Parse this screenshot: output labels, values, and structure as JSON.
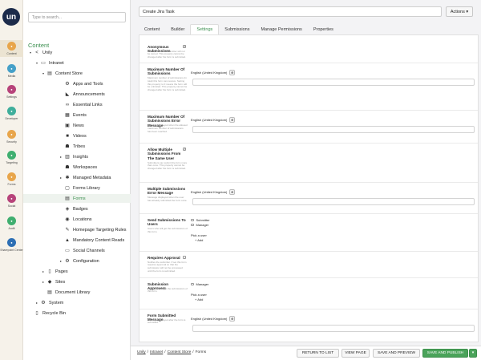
{
  "app": {
    "logo_text": "un"
  },
  "rail": [
    {
      "label": "Content",
      "icon": "content-icon",
      "color": "#e8a54a",
      "active": true
    },
    {
      "label": "Media",
      "icon": "media-icon",
      "color": "#46a0c8"
    },
    {
      "label": "Settings",
      "icon": "settings-icon",
      "color": "#b7437a"
    },
    {
      "label": "Developer",
      "icon": "developer-icon",
      "color": "#3fae9b"
    },
    {
      "label": "Security",
      "icon": "security-icon",
      "color": "#e8a54a"
    },
    {
      "label": "Targeting",
      "icon": "targeting-icon",
      "color": "#3fae6f"
    },
    {
      "label": "Forms",
      "icon": "forms-icon",
      "color": "#e8a54a"
    },
    {
      "label": "Social",
      "icon": "social-icon",
      "color": "#b7437a"
    },
    {
      "label": "Audit",
      "icon": "audit-icon",
      "color": "#3fae6f"
    },
    {
      "label": "Sharepoint Center",
      "icon": "sharepoint-icon",
      "color": "#2d6fb4"
    }
  ],
  "tree": {
    "search_placeholder": "Type to search...",
    "header": "Content",
    "nodes": [
      {
        "label": "Unily",
        "level": 0,
        "arrow": "▾",
        "icon": "share-icon",
        "glyph": "<"
      },
      {
        "label": "Intranet",
        "level": 1,
        "arrow": "▾",
        "icon": "monitor-icon",
        "glyph": "▭"
      },
      {
        "label": "Content Store",
        "level": 2,
        "arrow": "▾",
        "icon": "content-store-icon",
        "glyph": "▤"
      },
      {
        "label": "Apps and Tools",
        "level": 3,
        "arrow": "",
        "icon": "apps-icon",
        "glyph": "⚙"
      },
      {
        "label": "Announcements",
        "level": 3,
        "arrow": "",
        "icon": "megaphone-icon",
        "glyph": "◣"
      },
      {
        "label": "Essential Links",
        "level": 3,
        "arrow": "",
        "icon": "link-icon",
        "glyph": "∞"
      },
      {
        "label": "Events",
        "level": 3,
        "arrow": "",
        "icon": "calendar-icon",
        "glyph": "▦"
      },
      {
        "label": "News",
        "level": 3,
        "arrow": "",
        "icon": "news-icon",
        "glyph": "▣"
      },
      {
        "label": "Videos",
        "level": 3,
        "arrow": "",
        "icon": "video-icon",
        "glyph": "■"
      },
      {
        "label": "Tribes",
        "level": 3,
        "arrow": "",
        "icon": "tribes-icon",
        "glyph": "☗"
      },
      {
        "label": "Insights",
        "level": 3,
        "arrow": "▸",
        "icon": "insights-icon",
        "glyph": "▥"
      },
      {
        "label": "Workspaces",
        "level": 3,
        "arrow": "",
        "icon": "workspaces-icon",
        "glyph": "☗"
      },
      {
        "label": "Managed Metadata",
        "level": 3,
        "arrow": "▸",
        "icon": "metadata-icon",
        "glyph": "✱"
      },
      {
        "label": "Forms Library",
        "level": 3,
        "arrow": "",
        "icon": "forms-library-icon",
        "glyph": "▢"
      },
      {
        "label": "Forms",
        "level": 3,
        "arrow": "",
        "icon": "forms-icon",
        "glyph": "▤",
        "active": true
      },
      {
        "label": "Badges",
        "level": 3,
        "arrow": "",
        "icon": "badge-icon",
        "glyph": "◈"
      },
      {
        "label": "Locations",
        "level": 3,
        "arrow": "",
        "icon": "location-icon",
        "glyph": "◉"
      },
      {
        "label": "Homepage Targeting Rules",
        "level": 3,
        "arrow": "",
        "icon": "targeting-rules-icon",
        "glyph": "✎"
      },
      {
        "label": "Mandatory Content Reads",
        "level": 3,
        "arrow": "",
        "icon": "warning-icon",
        "glyph": "▲"
      },
      {
        "label": "Social Channels",
        "level": 3,
        "arrow": "",
        "icon": "social-channels-icon",
        "glyph": "▭"
      },
      {
        "label": "Configuration",
        "level": 3,
        "arrow": "▸",
        "icon": "configuration-icon",
        "glyph": "⚙"
      },
      {
        "label": "Pages",
        "level": 2,
        "arrow": "▸",
        "icon": "pages-icon",
        "glyph": "▯"
      },
      {
        "label": "Sites",
        "level": 2,
        "arrow": "▸",
        "icon": "sites-icon",
        "glyph": "◆"
      },
      {
        "label": "Document Library",
        "level": 2,
        "arrow": "",
        "icon": "document-library-icon",
        "glyph": "▤"
      },
      {
        "label": "System",
        "level": 1,
        "arrow": "▸",
        "icon": "system-icon",
        "glyph": "⚙"
      },
      {
        "label": "Recycle Bin",
        "level": 0,
        "arrow": "",
        "icon": "recycle-bin-icon",
        "glyph": "▯"
      }
    ]
  },
  "header": {
    "title_value": "Create Jira Task",
    "actions_label": "Actions ▾",
    "tabs": [
      {
        "label": "Content"
      },
      {
        "label": "Builder"
      },
      {
        "label": "Settings",
        "active": true
      },
      {
        "label": "Submissions"
      },
      {
        "label": "Manage Permissions"
      },
      {
        "label": "Properties"
      }
    ]
  },
  "settings": {
    "language": "English (United Kingdom)",
    "props": [
      {
        "label": "Anonymous Submissions",
        "desc": "If true, data of the submitter will not be stored. This property cannot be changed after the form is submitted."
      },
      {
        "label": "Maximum Number Of Submissions",
        "desc": "Maximum number of submissions (in total) this form can receive. Setting this property to 0 means the form will be unlimited. This property cannot be changed after the form is submitted."
      },
      {
        "label": "Maximum Number Of Submissions Error Message",
        "desc": "Message displayed when the allowed maximum number of submissions has been reached."
      },
      {
        "label": "Allow Multiple Submissions From The Same User",
        "desc": "Submitters can submit the form more than once. This property cannot be changed after the form is submitted."
      },
      {
        "label": "Multiple Submissions Error Message",
        "desc": "Message displayed when the user has already submitted the form once."
      },
      {
        "label": "Send Submissions To Users",
        "desc": "Users who will get the submissions of this form.",
        "options": [
          "Submitter",
          "Manager"
        ],
        "pick": "Pick a user",
        "add": "+ Add"
      },
      {
        "label": "Requires Approval",
        "desc": "Notifies the submitter. If set this form requires approval so that the submission will not be processed until the form is submitted."
      },
      {
        "label": "Submission Approvers",
        "desc": "Users who will get the submissions of this form.",
        "options": [
          "Manager"
        ],
        "pick": "Pick a user",
        "add": "+ Add"
      },
      {
        "label": "Form Submitted Message",
        "desc": "Message displayed after the form is submitted."
      }
    ]
  },
  "footer": {
    "crumbs": [
      "Unily",
      "Intranet",
      "Content Store",
      "Forms"
    ],
    "separator": "/",
    "return_label": "RETURN TO LIST",
    "view_label": "VIEW PAGE",
    "save_preview_label": "SAVE AND PREVIEW",
    "save_publish_label": "SAVE AND PUBLISH",
    "dropdown_label": "▾"
  }
}
